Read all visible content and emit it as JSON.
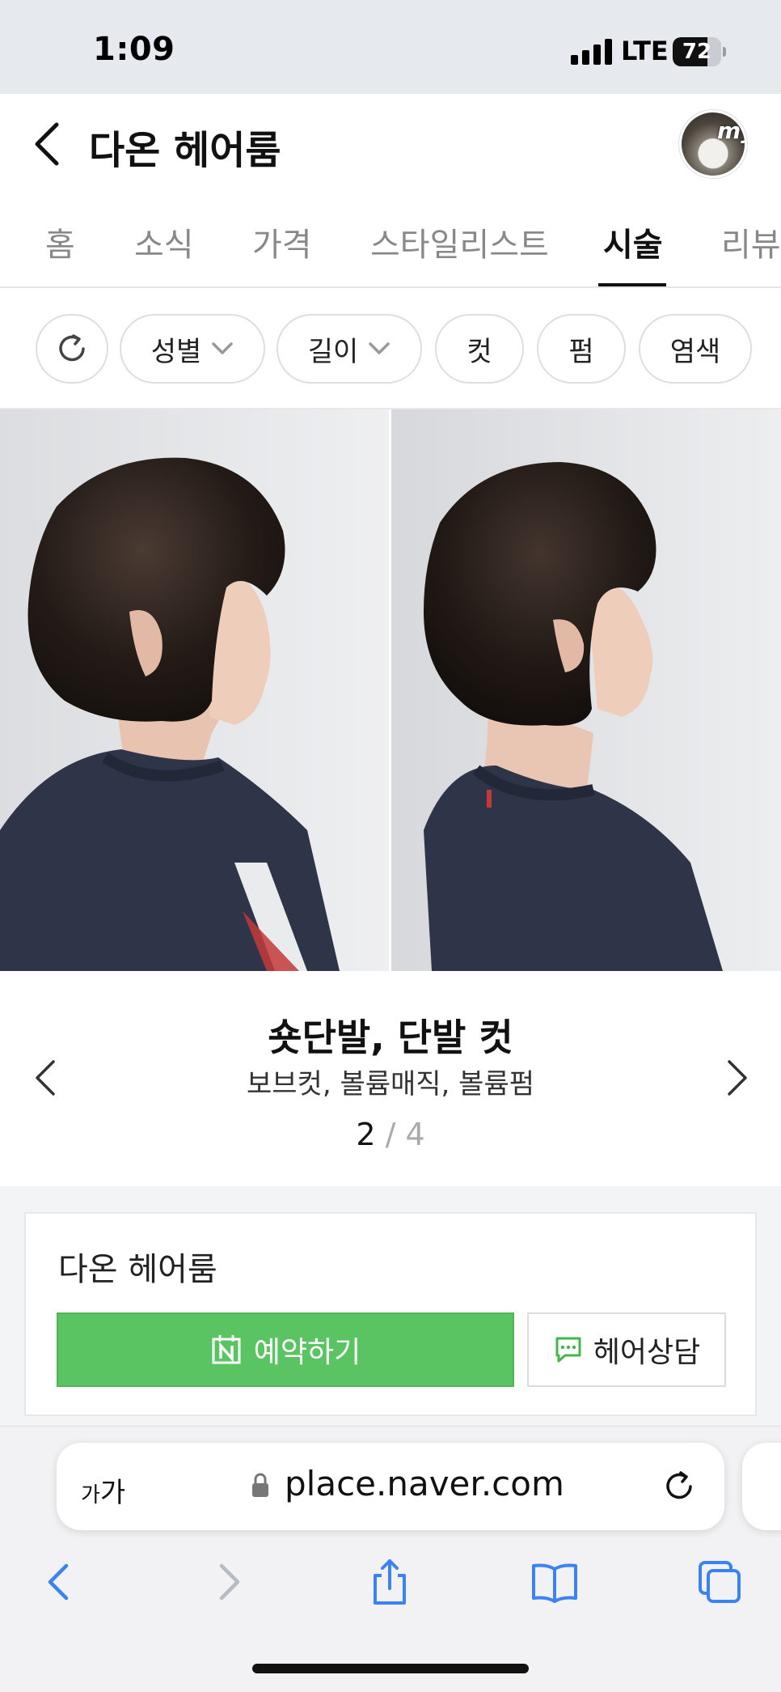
{
  "status_bar": {
    "time": "1:09",
    "network": "LTE",
    "battery": "72",
    "battery_level": 0.72
  },
  "header": {
    "title": "다온 헤어룸",
    "avatar_text": "my"
  },
  "tabs": [
    {
      "label": "홈",
      "active": false
    },
    {
      "label": "소식",
      "active": false
    },
    {
      "label": "가격",
      "active": false
    },
    {
      "label": "스타일리스트",
      "active": false
    },
    {
      "label": "시술",
      "active": true
    },
    {
      "label": "리뷰",
      "active": false
    }
  ],
  "filters": {
    "reset_icon": "refresh-icon",
    "chips": [
      {
        "label": "성별",
        "dropdown": true
      },
      {
        "label": "길이",
        "dropdown": true
      },
      {
        "label": "컷",
        "dropdown": false
      },
      {
        "label": "펌",
        "dropdown": false
      },
      {
        "label": "염색",
        "dropdown": false
      }
    ]
  },
  "style": {
    "title": "숏단발, 단발 컷",
    "tags": "보브컷, 볼륨매직, 볼륨펌",
    "pager": {
      "current": "2",
      "separator": "/",
      "total": "4"
    }
  },
  "booking": {
    "name": "다온 헤어룸",
    "reserve_label": "예약하기",
    "consult_label": "헤어상담",
    "accent_color": "#5bc462"
  },
  "browser": {
    "text_size_label_small": "가",
    "text_size_label_large": "가",
    "url": "place.naver.com",
    "accent_color": "#3b82f6"
  }
}
